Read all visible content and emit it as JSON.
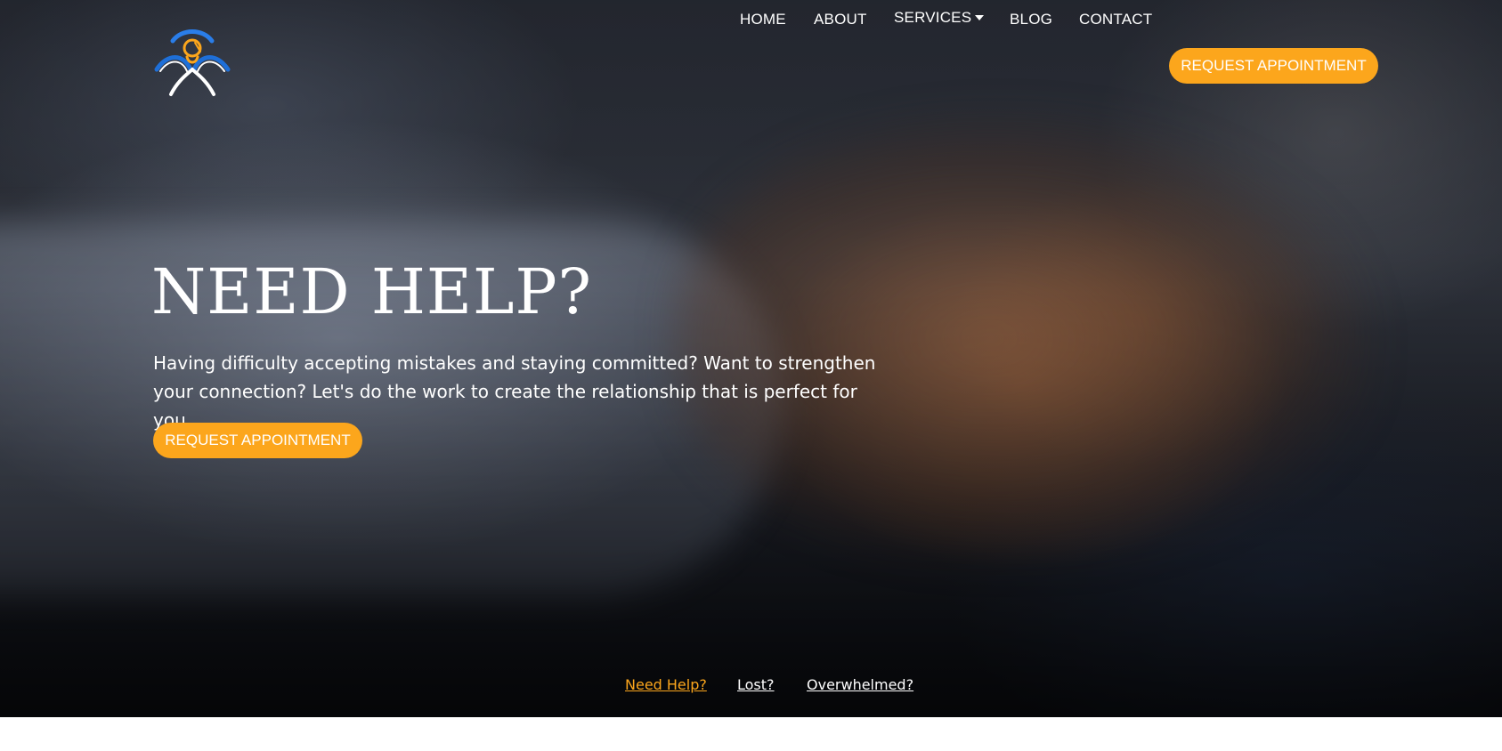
{
  "brand": {
    "logo_icon": "counseling-figures-logo-icon",
    "colors": {
      "accent": "#fca61c",
      "logo_blue": "#1e6fd8",
      "text": "#ffffff"
    }
  },
  "nav": {
    "items": [
      {
        "label": "HOME"
      },
      {
        "label": "ABOUT"
      },
      {
        "label": "SERVICES",
        "icon": "caret-down-icon"
      },
      {
        "label": "BLOG"
      },
      {
        "label": "CONTACT"
      }
    ],
    "cta_label": "REQUEST APPOINTMENT"
  },
  "hero": {
    "title": "NEED HELP?",
    "text": "Having difficulty accepting mistakes and staying committed? Want to strengthen your connection? Let's do the work to create the relationship that is perfect for you.",
    "cta_label": "REQUEST APPOINTMENT",
    "background": "holding-hands-photo"
  },
  "slider": {
    "tabs": [
      {
        "label": "Need Help?",
        "active": true
      },
      {
        "label": "Lost?",
        "active": false
      },
      {
        "label": "Overwhelmed?",
        "active": false
      }
    ]
  }
}
